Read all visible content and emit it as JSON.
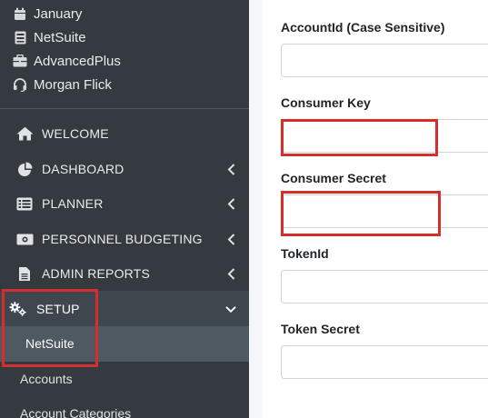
{
  "sidebar": {
    "meta": [
      {
        "icon": "calendar-icon",
        "label": "January"
      },
      {
        "icon": "server-icon",
        "label": "NetSuite"
      },
      {
        "icon": "briefcase-icon",
        "label": "AdvancedPlus"
      },
      {
        "icon": "headset-icon",
        "label": "Morgan Flick"
      }
    ],
    "nav": [
      {
        "icon": "home-icon",
        "label": "WELCOME"
      },
      {
        "icon": "chart-pie-icon",
        "label": "DASHBOARD"
      },
      {
        "icon": "list-icon",
        "label": "PLANNER"
      },
      {
        "icon": "money-bill-icon",
        "label": "PERSONNEL BUDGETING"
      },
      {
        "icon": "file-icon",
        "label": "ADMIN REPORTS"
      },
      {
        "icon": "cogs-icon",
        "label": "SETUP"
      }
    ],
    "setup_sub": [
      "NetSuite",
      "Accounts",
      "Account Categories"
    ]
  },
  "form": {
    "fields": [
      {
        "label": "AccountId (Case Sensitive)",
        "value": ""
      },
      {
        "label": "Consumer Key",
        "value": ""
      },
      {
        "label": "Consumer Secret",
        "value": ""
      },
      {
        "label": "TokenId",
        "value": ""
      },
      {
        "label": "Token Secret",
        "value": ""
      }
    ]
  },
  "colors": {
    "sidebar_bg": "#343a40",
    "highlight": "#d62d2d",
    "active_sub": "#4f5961"
  }
}
